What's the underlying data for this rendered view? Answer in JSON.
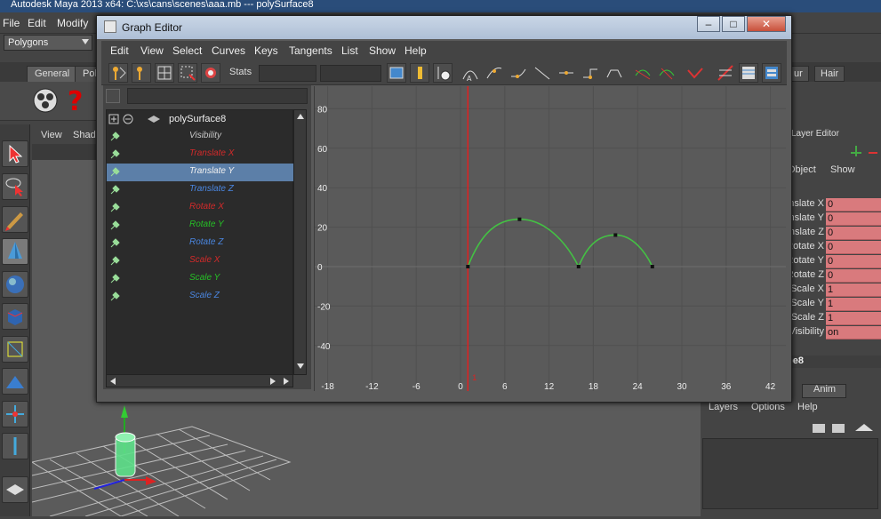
{
  "window": {
    "title": "Autodesk Maya 2013 x64: C:\\xs\\cans\\scenes\\aaa.mb   ---   polySurface8"
  },
  "main_menu": [
    "File",
    "Edit",
    "Modify"
  ],
  "menu_set": "Polygons",
  "shelf_tabs": [
    "General",
    "Polygons"
  ],
  "right_shelf_tabs": [
    "ur",
    "Hair"
  ],
  "viewport_menu": [
    "View",
    "Shad"
  ],
  "graph_editor": {
    "title": "Graph Editor",
    "menu": [
      "Edit",
      "View",
      "Select",
      "Curves",
      "Keys",
      "Tangents",
      "List",
      "Show",
      "Help"
    ],
    "stats_label": "Stats",
    "outliner": {
      "object": "polySurface8",
      "channels": [
        {
          "label": "Visibility",
          "color": "#c8c8c8",
          "selected": false
        },
        {
          "label": "Translate X",
          "color": "#d32a2a",
          "selected": false
        },
        {
          "label": "Translate Y",
          "color": "#f0f0f0",
          "selected": true
        },
        {
          "label": "Translate Z",
          "color": "#4a86e0",
          "selected": false
        },
        {
          "label": "Rotate X",
          "color": "#d32a2a",
          "selected": false
        },
        {
          "label": "Rotate Y",
          "color": "#26c026",
          "selected": false
        },
        {
          "label": "Rotate Z",
          "color": "#4a86e0",
          "selected": false
        },
        {
          "label": "Scale X",
          "color": "#d32a2a",
          "selected": false
        },
        {
          "label": "Scale Y",
          "color": "#26c026",
          "selected": false
        },
        {
          "label": "Scale Z",
          "color": "#4a86e0",
          "selected": false
        }
      ]
    },
    "graph": {
      "y_ticks": [
        "80",
        "60",
        "40",
        "20",
        "0",
        "-20",
        "-40"
      ],
      "x_ticks": [
        "-18",
        "-12",
        "-6",
        "0",
        "6",
        "12",
        "18",
        "24",
        "30",
        "36",
        "42"
      ],
      "current_frame": "1",
      "curve_color": "#44c044",
      "time_indicator_color": "#e02020",
      "keys": [
        {
          "frame": 1,
          "value": 0
        },
        {
          "frame": 8,
          "value": 24
        },
        {
          "frame": 16,
          "value": 0
        },
        {
          "frame": 21,
          "value": 16
        },
        {
          "frame": 26,
          "value": 0
        }
      ]
    }
  },
  "channel_box": {
    "header": "Layer Editor",
    "menu": [
      "Object",
      "Show"
    ],
    "rows": [
      {
        "label": "Translate X",
        "value": "0"
      },
      {
        "label": "Translate Y",
        "value": "0"
      },
      {
        "label": "Translate Z",
        "value": "0"
      },
      {
        "label": "Rotate X",
        "value": "0"
      },
      {
        "label": "Rotate Y",
        "value": "0"
      },
      {
        "label": "Rotate Z",
        "value": "0"
      },
      {
        "label": "Scale X",
        "value": "1"
      },
      {
        "label": "Scale Y",
        "value": "1"
      },
      {
        "label": "Scale Z",
        "value": "1"
      },
      {
        "label": "Visibility",
        "value": "on"
      }
    ],
    "shape_label": "pe8"
  },
  "layer_editor": {
    "tabs": [
      "Anim"
    ],
    "menu": [
      "Layers",
      "Options",
      "Help"
    ]
  }
}
